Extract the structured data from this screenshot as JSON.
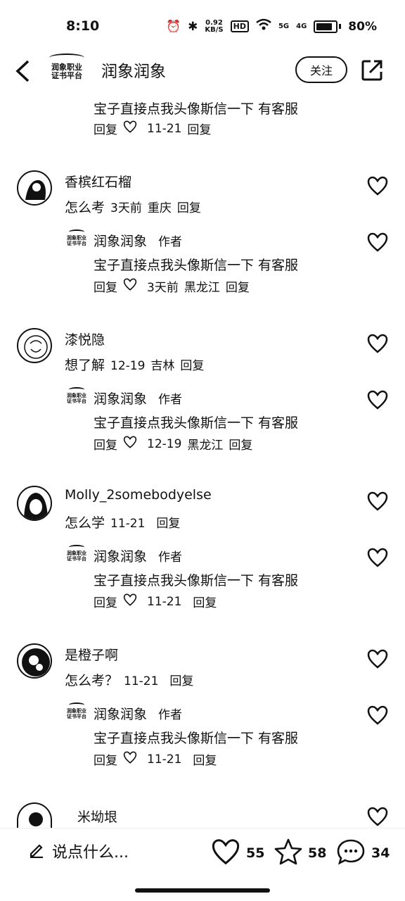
{
  "status": {
    "time": "8:10",
    "network_speed": "0.92",
    "network_unit": "KB/S",
    "hd": "HD",
    "signal1": "5G",
    "signal2": "4G",
    "battery": "80%"
  },
  "header": {
    "logo_line1": "润象职业",
    "logo_line2": "证书平台",
    "title": "润象润象",
    "follow_label": "关注"
  },
  "top_partial": {
    "text": "宝子直接点我头像斯信一下 有客服",
    "reply1": "回复",
    "date": "11-21",
    "reply2": "回复"
  },
  "comments": [
    {
      "user": "香槟红石榴",
      "text": "怎么考",
      "date": "3天前",
      "location": "重庆",
      "reply": "回复",
      "author_reply": {
        "name": "润象润象",
        "tag": "作者",
        "text": "宝子直接点我头像斯信一下 有客服",
        "reply1": "回复",
        "date": "3天前",
        "location": "黑龙江",
        "reply2": "回复"
      }
    },
    {
      "user": "漆悦隐",
      "text": "想了解",
      "date": "12-19",
      "location": "吉林",
      "reply": "回复",
      "author_reply": {
        "name": "润象润象",
        "tag": "作者",
        "text": "宝子直接点我头像斯信一下 有客服",
        "reply1": "回复",
        "date": "12-19",
        "location": "黑龙江",
        "reply2": "回复"
      }
    },
    {
      "user": "Molly_2somebodyelse",
      "text": "怎么学",
      "date": "11-21",
      "location": "",
      "reply": "回复",
      "author_reply": {
        "name": "润象润象",
        "tag": "作者",
        "text": "宝子直接点我头像斯信一下 有客服",
        "reply1": "回复",
        "date": "11-21",
        "location": "",
        "reply2": "回复"
      }
    },
    {
      "user": "是橙子啊",
      "text": "怎么考？",
      "date": "11-21",
      "location": "",
      "reply": "回复",
      "author_reply": {
        "name": "润象润象",
        "tag": "作者",
        "text": "宝子直接点我头像斯信一下 有客服",
        "reply1": "回复",
        "date": "11-21",
        "location": "",
        "reply2": "回复"
      }
    }
  ],
  "partial_user": "米坳垠",
  "bottom": {
    "placeholder": "说点什么...",
    "likes": "55",
    "stars": "58",
    "comments": "34"
  }
}
